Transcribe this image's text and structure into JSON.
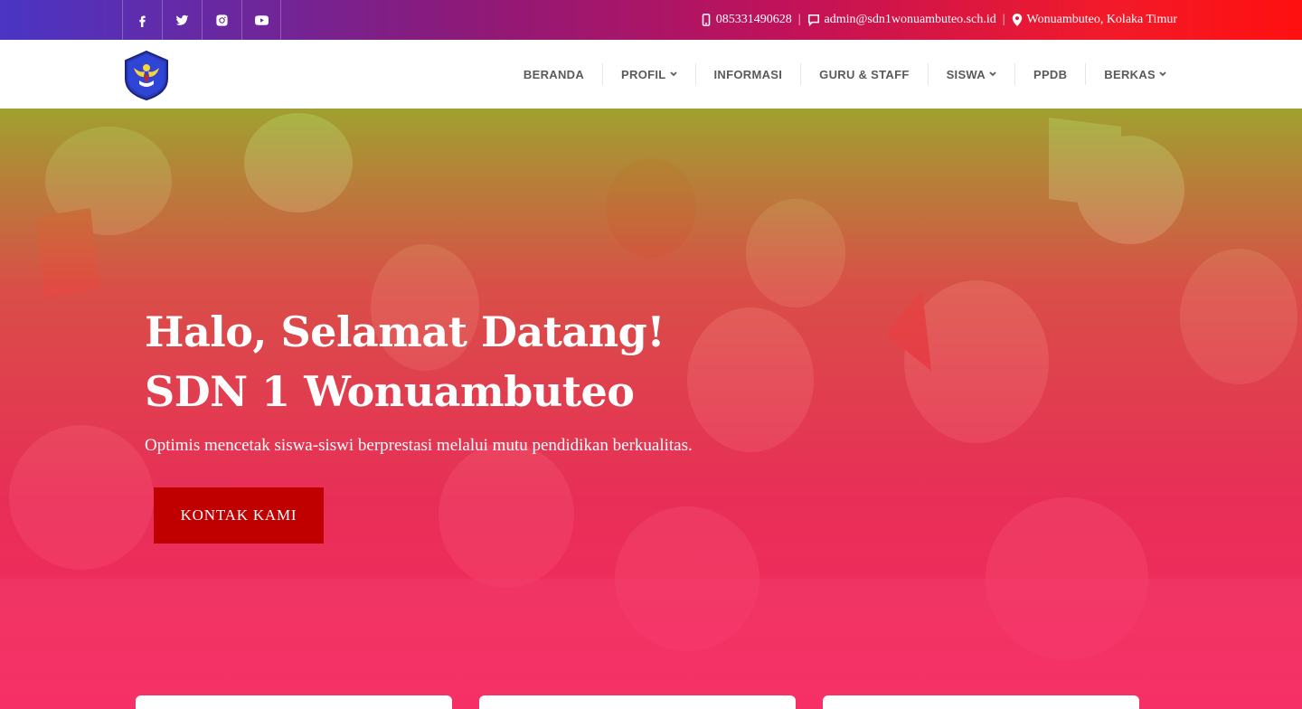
{
  "topbar": {
    "social": [
      {
        "icon": "facebook-icon"
      },
      {
        "icon": "twitter-icon"
      },
      {
        "icon": "instagram-icon"
      },
      {
        "icon": "youtube-icon"
      }
    ],
    "phone": "085331490628",
    "email": "admin@sdn1wonuambuteo.sch.id",
    "address": "Wonuambuteo, Kolaka Timur",
    "separator": "|"
  },
  "nav": {
    "items": [
      {
        "label": "BERANDA",
        "dropdown": false
      },
      {
        "label": "PROFIL",
        "dropdown": true
      },
      {
        "label": "INFORMASI",
        "dropdown": false
      },
      {
        "label": "GURU & STAFF",
        "dropdown": false
      },
      {
        "label": "SISWA",
        "dropdown": true
      },
      {
        "label": "PPDB",
        "dropdown": false
      },
      {
        "label": "BERKAS",
        "dropdown": true
      }
    ]
  },
  "hero": {
    "title_line1": "Halo, Selamat Datang!",
    "title_line2": "SDN 1 Wonuambuteo",
    "subtitle": "Optimis mencetak siswa-siswi berprestasi melalui mutu pendidikan berkualitas.",
    "cta_label": "KONTAK KAMI"
  },
  "colors": {
    "cta": "#c00000",
    "topbar_start": "#4a35c4",
    "topbar_end": "#ff1010",
    "overlay": "#f02860"
  }
}
